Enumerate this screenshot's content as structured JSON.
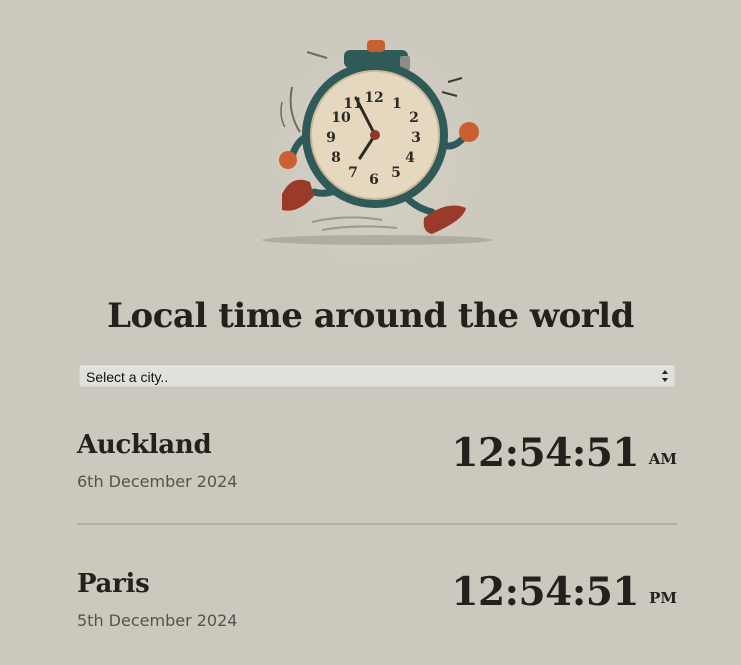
{
  "page": {
    "title": "Local time around the world",
    "illustration_icon": "running-alarm-clock"
  },
  "city_select": {
    "selected": "Select a city.."
  },
  "cities": [
    {
      "name": "Auckland",
      "date": "6th December 2024",
      "time": "12:54:51",
      "period": "AM"
    },
    {
      "name": "Paris",
      "date": "5th December 2024",
      "time": "12:54:51",
      "period": "PM"
    }
  ],
  "colors": {
    "background": "#cbc8bd",
    "text": "#23211c",
    "secondary_text": "#55534c",
    "divider": "#b3b0a7"
  }
}
